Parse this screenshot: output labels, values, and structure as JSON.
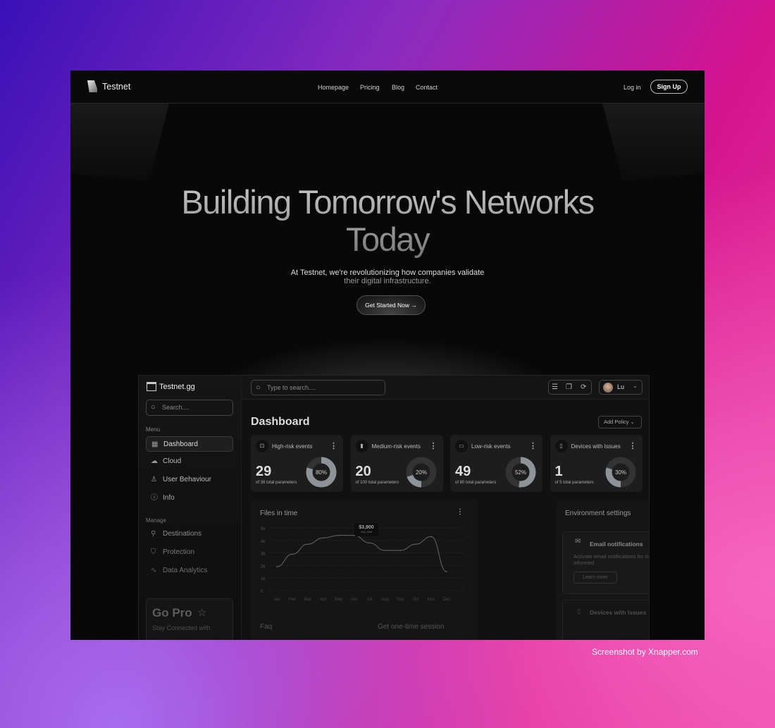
{
  "nav": {
    "brand": "Testnet",
    "links": [
      "Homepage",
      "Pricing",
      "Blog",
      "Contact"
    ],
    "login": "Log in",
    "signup": "Sign Up"
  },
  "hero": {
    "title_line1": "Building Tomorrow's Networks",
    "title_line2": "Today",
    "subtitle_line1": "At Testnet, we're revolutionizing how companies validate",
    "subtitle_line2": "their digital infrastructure.",
    "cta": "Get Started Now →"
  },
  "dashboard": {
    "brand": "Testnet.gg",
    "sidebar_search_placeholder": "Search....",
    "menu_label": "Menu",
    "menu": [
      {
        "label": "Dashboard",
        "icon": "grid-icon"
      },
      {
        "label": "Cloud",
        "icon": "cloud-icon"
      },
      {
        "label": "User Behaviour",
        "icon": "user-icon"
      },
      {
        "label": "Info",
        "icon": "info-icon"
      }
    ],
    "manage_label": "Manage",
    "manage": [
      {
        "label": "Destinations",
        "icon": "destinations-icon"
      },
      {
        "label": "Protection",
        "icon": "shield-icon"
      },
      {
        "label": "Data Analytics",
        "icon": "activity-icon"
      }
    ],
    "gopro": {
      "title": "Go Pro",
      "text": "Stay Connected with"
    },
    "top_search_placeholder": "Type to search....",
    "user": "Lu",
    "title": "Dashboard",
    "add_policy": "Add Policy",
    "kpis": [
      {
        "title": "High-risk events",
        "value": "29",
        "sub": "of 38 total parameters",
        "percent": 80,
        "icon": "lock-icon"
      },
      {
        "title": "Medium-risk events",
        "value": "20",
        "sub": "of 100 total parameters",
        "percent": 20,
        "icon": "signal-icon"
      },
      {
        "title": "Low-risk events",
        "value": "49",
        "sub": "of 80 total parameters",
        "percent": 52,
        "icon": "battery-icon"
      },
      {
        "title": "Devices with Issues",
        "value": "1",
        "sub": "of 5 total parameters",
        "percent": 30,
        "icon": "phone-icon"
      }
    ],
    "env": {
      "title": "Environment settings",
      "email_title": "Email notifications",
      "email_text": "Activate email notifications for risky events to be informed",
      "learn_more": "Learn more",
      "devices_title": "Devices with Issues"
    },
    "bottom": {
      "faq": "Faq",
      "session": "Get one-time session"
    }
  },
  "chart_data": {
    "type": "line",
    "title": "Files in time",
    "categories": [
      "Jan",
      "Feb",
      "Mar",
      "Apr",
      "May",
      "Jun",
      "Jul",
      "Aug",
      "Sep",
      "Oct",
      "Nov",
      "Dec"
    ],
    "y_ticks": [
      "0",
      "1k",
      "2k",
      "3k",
      "4k",
      "5k"
    ],
    "ylim": [
      0,
      5000
    ],
    "values": [
      1900,
      2900,
      3700,
      4200,
      4400,
      4400,
      3800,
      3200,
      3200,
      3700,
      4300,
      1500
    ],
    "tooltip": {
      "value": "$3,900",
      "date": "July 18th"
    }
  },
  "credit": "Screenshot by Xnapper.com"
}
